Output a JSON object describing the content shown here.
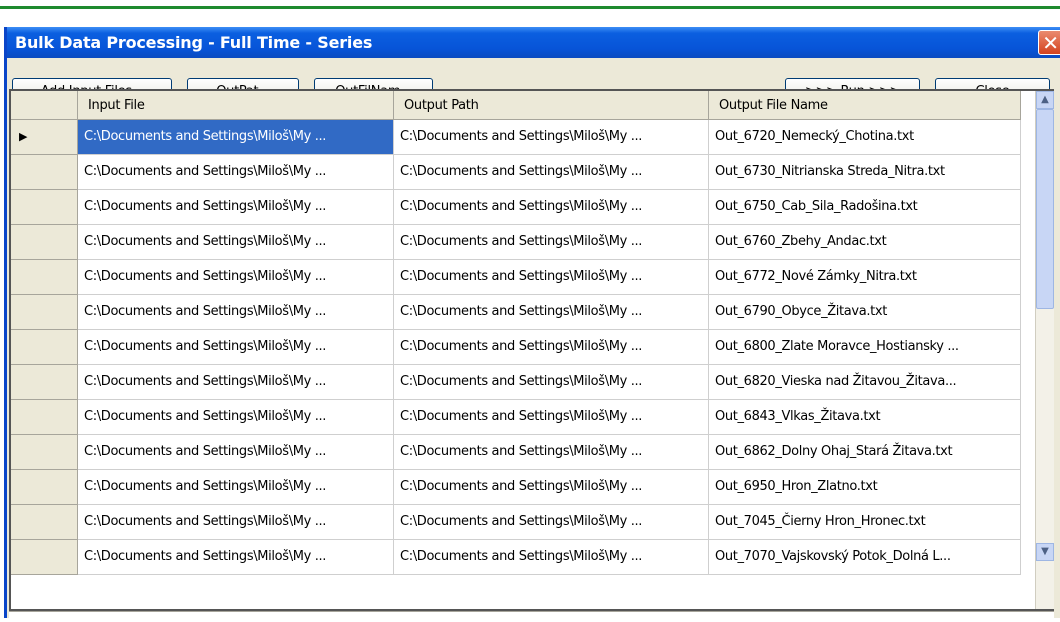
{
  "window": {
    "title": "Bulk Data Processing - Full Time - Series",
    "close_glyph": "✕"
  },
  "toolbar": {
    "add_input_files": "Add Input Files...",
    "out_path": "OutPat...",
    "out_file_name": "OutFilNam...",
    "run": ">>> Run >>>",
    "close": "Close"
  },
  "grid": {
    "columns": [
      "Input File",
      "Output Path",
      "Output File Name"
    ],
    "current_row_marker": "▶",
    "rows": [
      [
        "C:\\Documents and Settings\\Miloš\\My ...",
        "C:\\Documents and Settings\\Miloš\\My ...",
        "Out_6720_Nemecký_Chotina.txt"
      ],
      [
        "C:\\Documents and Settings\\Miloš\\My ...",
        "C:\\Documents and Settings\\Miloš\\My ...",
        "Out_6730_Nitrianska Streda_Nitra.txt"
      ],
      [
        "C:\\Documents and Settings\\Miloš\\My ...",
        "C:\\Documents and Settings\\Miloš\\My ...",
        "Out_6750_Cab_Sila_Radošina.txt"
      ],
      [
        "C:\\Documents and Settings\\Miloš\\My ...",
        "C:\\Documents and Settings\\Miloš\\My ...",
        "Out_6760_Zbehy_Andac.txt"
      ],
      [
        "C:\\Documents and Settings\\Miloš\\My ...",
        "C:\\Documents and Settings\\Miloš\\My ...",
        "Out_6772_Nové Zámky_Nitra.txt"
      ],
      [
        "C:\\Documents and Settings\\Miloš\\My ...",
        "C:\\Documents and Settings\\Miloš\\My ...",
        "Out_6790_Obyce_Žitava.txt"
      ],
      [
        "C:\\Documents and Settings\\Miloš\\My ...",
        "C:\\Documents and Settings\\Miloš\\My ...",
        "Out_6800_Zlate Moravce_Hostiansky ..."
      ],
      [
        "C:\\Documents and Settings\\Miloš\\My ...",
        "C:\\Documents and Settings\\Miloš\\My ...",
        "Out_6820_Vieska nad Žitavou_Žitava..."
      ],
      [
        "C:\\Documents and Settings\\Miloš\\My ...",
        "C:\\Documents and Settings\\Miloš\\My ...",
        "Out_6843_Vlkas_Žitava.txt"
      ],
      [
        "C:\\Documents and Settings\\Miloš\\My ...",
        "C:\\Documents and Settings\\Miloš\\My ...",
        "Out_6862_Dolny Ohaj_Stará Žitava.txt"
      ],
      [
        "C:\\Documents and Settings\\Miloš\\My ...",
        "C:\\Documents and Settings\\Miloš\\My ...",
        "Out_6950_Hron_Zlatno.txt"
      ],
      [
        "C:\\Documents and Settings\\Miloš\\My ...",
        "C:\\Documents and Settings\\Miloš\\My ...",
        "Out_7045_Čierny Hron_Hronec.txt"
      ],
      [
        "C:\\Documents and Settings\\Miloš\\My ...",
        "C:\\Documents and Settings\\Miloš\\My ...",
        "Out_7070_Vajskovský Potok_Dolná L..."
      ]
    ]
  },
  "scrollbar": {
    "up_glyph": "▲",
    "down_glyph": "▼"
  },
  "colors": {
    "selection": "#316ac5",
    "titlebar": "#0754d8",
    "accent_line": "#1e8a2e"
  }
}
